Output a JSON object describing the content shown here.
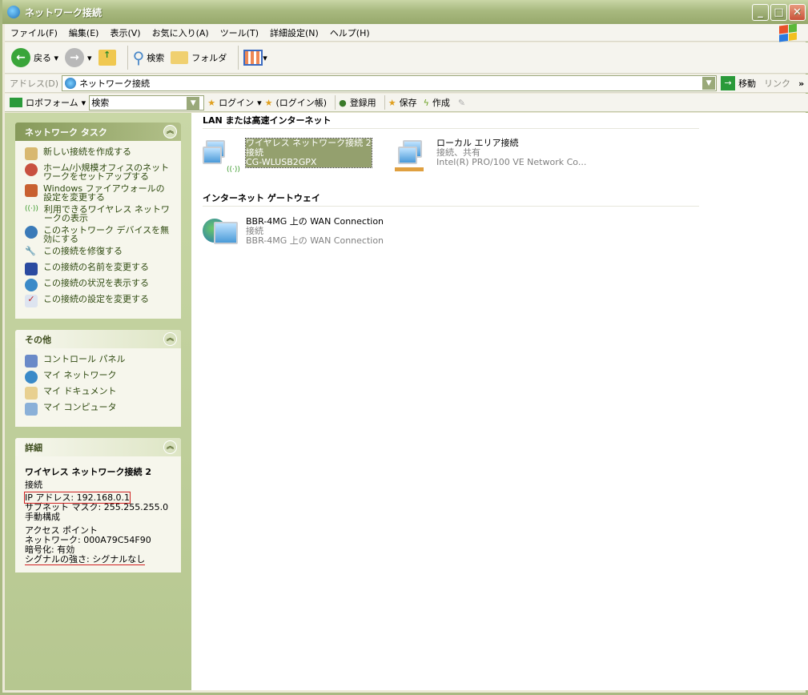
{
  "window": {
    "title": "ネットワーク接続",
    "controls": {
      "minimize": "_",
      "maximize": "□",
      "close": "✕"
    }
  },
  "menu": [
    "ファイル(F)",
    "編集(E)",
    "表示(V)",
    "お気に入り(A)",
    "ツール(T)",
    "詳細設定(N)",
    "ヘルプ(H)"
  ],
  "toolbar": {
    "back": "戻る",
    "search": "検索",
    "folders": "フォルダ"
  },
  "address": {
    "label": "アドレス(D)",
    "value": "ネットワーク接続",
    "go": "移動",
    "links": "リンク",
    "more": "»"
  },
  "roboform": {
    "name": "ロボフォーム",
    "search_value": "検索",
    "login": "ログイン",
    "login_book": "(ログイン帳)",
    "register": "登録用",
    "save": "保存",
    "create": "作成"
  },
  "sidebar": {
    "network_tasks": {
      "title": "ネットワーク タスク",
      "items": [
        "新しい接続を作成する",
        "ホーム/小規模オフィスのネットワークをセットアップする",
        "Windows ファイアウォールの設定を変更する",
        "利用できるワイヤレス ネットワークの表示",
        "このネットワーク デバイスを無効にする",
        "この接続を修復する",
        "この接続の名前を変更する",
        "この接続の状況を表示する",
        "この接続の設定を変更する"
      ]
    },
    "other": {
      "title": "その他",
      "items": [
        "コントロール パネル",
        "マイ ネットワーク",
        "マイ ドキュメント",
        "マイ コンピュータ"
      ]
    },
    "details": {
      "title": "詳細",
      "name": "ワイヤレス ネットワーク接続 2",
      "status": "接続",
      "ip": "IP アドレス: 192.168.0.1",
      "subnet": "サブネット マスク: 255.255.255.0",
      "config": "手動構成",
      "ap": "アクセス ポイント",
      "network": "ネットワーク: 000A79C54F90",
      "encryption": "暗号化: 有効",
      "signal": "シグナルの強さ: シグナルなし"
    }
  },
  "main": {
    "groups": [
      {
        "title": "LAN または高速インターネット"
      },
      {
        "title": "インターネット ゲートウェイ"
      }
    ],
    "items": [
      {
        "name": "ワイヤレス ネットワーク接続 2",
        "status": "接続",
        "device": "CG-WLUSB2GPX"
      },
      {
        "name": "ローカル エリア接続",
        "status": "接続、共有",
        "device": "Intel(R) PRO/100 VE Network Co..."
      },
      {
        "name": "BBR-4MG 上の WAN Connection",
        "status": "接続",
        "device": "BBR-4MG 上の WAN Connection"
      }
    ]
  },
  "colors": {
    "accent": "#86995a",
    "selection": "#94a06e",
    "link": "#2f4a10"
  }
}
